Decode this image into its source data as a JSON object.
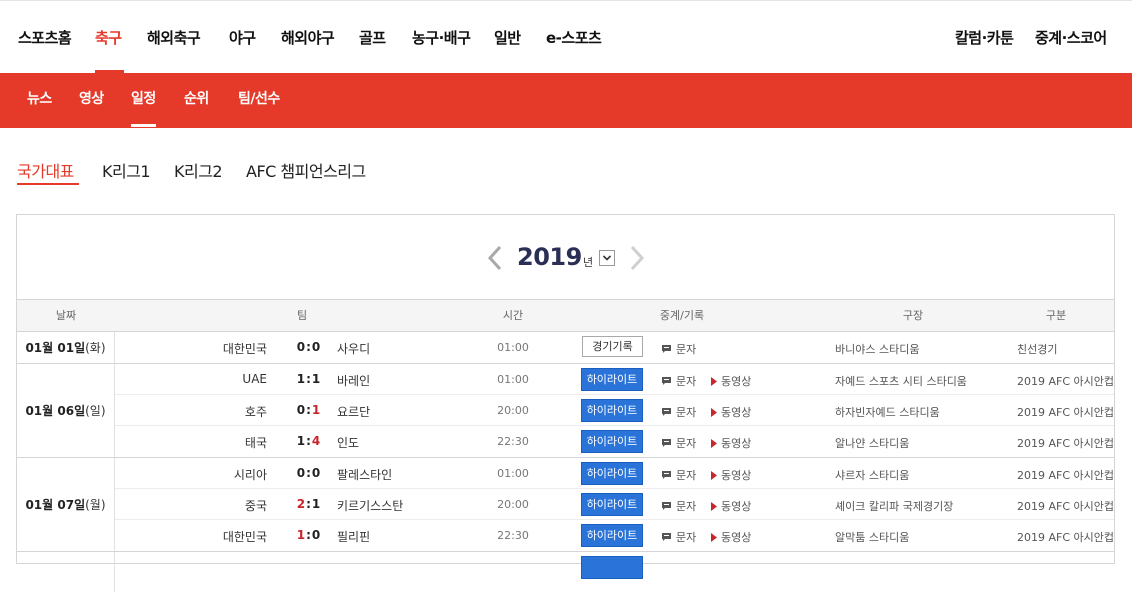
{
  "main_nav": [
    {
      "label": "스포츠홈",
      "active": false
    },
    {
      "label": "축구",
      "active": true
    },
    {
      "label": "해외축구",
      "active": false
    },
    {
      "label": "야구",
      "active": false
    },
    {
      "label": "해외야구",
      "active": false
    },
    {
      "label": "골프",
      "active": false
    },
    {
      "label": "농구·배구",
      "active": false
    },
    {
      "label": "일반",
      "active": false
    },
    {
      "label": "e-스포츠",
      "active": false
    }
  ],
  "right_nav": [
    "칼럼·카툰",
    "중계·스코어"
  ],
  "sub_nav": [
    {
      "label": "뉴스",
      "active": false
    },
    {
      "label": "영상",
      "active": false
    },
    {
      "label": "일정",
      "active": true
    },
    {
      "label": "순위",
      "active": false
    },
    {
      "label": "팀/선수",
      "active": false
    }
  ],
  "league_tabs": [
    {
      "label": "국가대표",
      "active": true
    },
    {
      "label": "K리그1",
      "active": false
    },
    {
      "label": "K리그2",
      "active": false
    },
    {
      "label": "AFC 챔피언스리그",
      "active": false
    }
  ],
  "year": {
    "value": "2019",
    "unit": "년"
  },
  "columns": {
    "date": "날짜",
    "team": "팀",
    "time": "시간",
    "broadcast": "중계/기록",
    "venue": "구장",
    "category": "구분"
  },
  "labels": {
    "record": "경기기록",
    "highlight": "하이라이트",
    "text": "문자",
    "video": "동영상"
  },
  "colors": {
    "accent": "#e53a2a",
    "highlight_button": "#2a74d9",
    "score_win": "#c9262b"
  },
  "groups": [
    {
      "date_md": "01월 01일",
      "weekday": "(화)",
      "matches": [
        {
          "home": "대한민국",
          "home_score": "0",
          "away_score": "0",
          "away": "사우디",
          "winner": "none",
          "time": "01:00",
          "has_highlight": false,
          "has_record": true,
          "has_video": false,
          "venue": "바니야스 스타디움",
          "category": "친선경기"
        }
      ]
    },
    {
      "date_md": "01월 06일",
      "weekday": "(일)",
      "matches": [
        {
          "home": "UAE",
          "home_score": "1",
          "away_score": "1",
          "away": "바레인",
          "winner": "none",
          "time": "01:00",
          "has_highlight": true,
          "has_record": false,
          "has_video": true,
          "venue": "자예드 스포츠 시티 스타디움",
          "category": "2019 AFC 아시안컵"
        },
        {
          "home": "호주",
          "home_score": "0",
          "away_score": "1",
          "away": "요르단",
          "winner": "away",
          "time": "20:00",
          "has_highlight": true,
          "has_record": false,
          "has_video": true,
          "venue": "하자빈자예드 스타디움",
          "category": "2019 AFC 아시안컵"
        },
        {
          "home": "태국",
          "home_score": "1",
          "away_score": "4",
          "away": "인도",
          "winner": "away",
          "time": "22:30",
          "has_highlight": true,
          "has_record": false,
          "has_video": true,
          "venue": "알나얀 스타디움",
          "category": "2019 AFC 아시안컵"
        }
      ]
    },
    {
      "date_md": "01월 07일",
      "weekday": "(월)",
      "matches": [
        {
          "home": "시리아",
          "home_score": "0",
          "away_score": "0",
          "away": "팔레스타인",
          "winner": "none",
          "time": "01:00",
          "has_highlight": true,
          "has_record": false,
          "has_video": true,
          "venue": "샤르자 스타디움",
          "category": "2019 AFC 아시안컵"
        },
        {
          "home": "중국",
          "home_score": "2",
          "away_score": "1",
          "away": "키르기스스탄",
          "winner": "home",
          "time": "20:00",
          "has_highlight": true,
          "has_record": false,
          "has_video": true,
          "venue": "셰이크 칼리파 국제경기장",
          "category": "2019 AFC 아시안컵"
        },
        {
          "home": "대한민국",
          "home_score": "1",
          "away_score": "0",
          "away": "필리핀",
          "winner": "home",
          "time": "22:30",
          "has_highlight": true,
          "has_record": false,
          "has_video": true,
          "venue": "알막툼 스타디움",
          "category": "2019 AFC 아시안컵"
        }
      ]
    }
  ]
}
